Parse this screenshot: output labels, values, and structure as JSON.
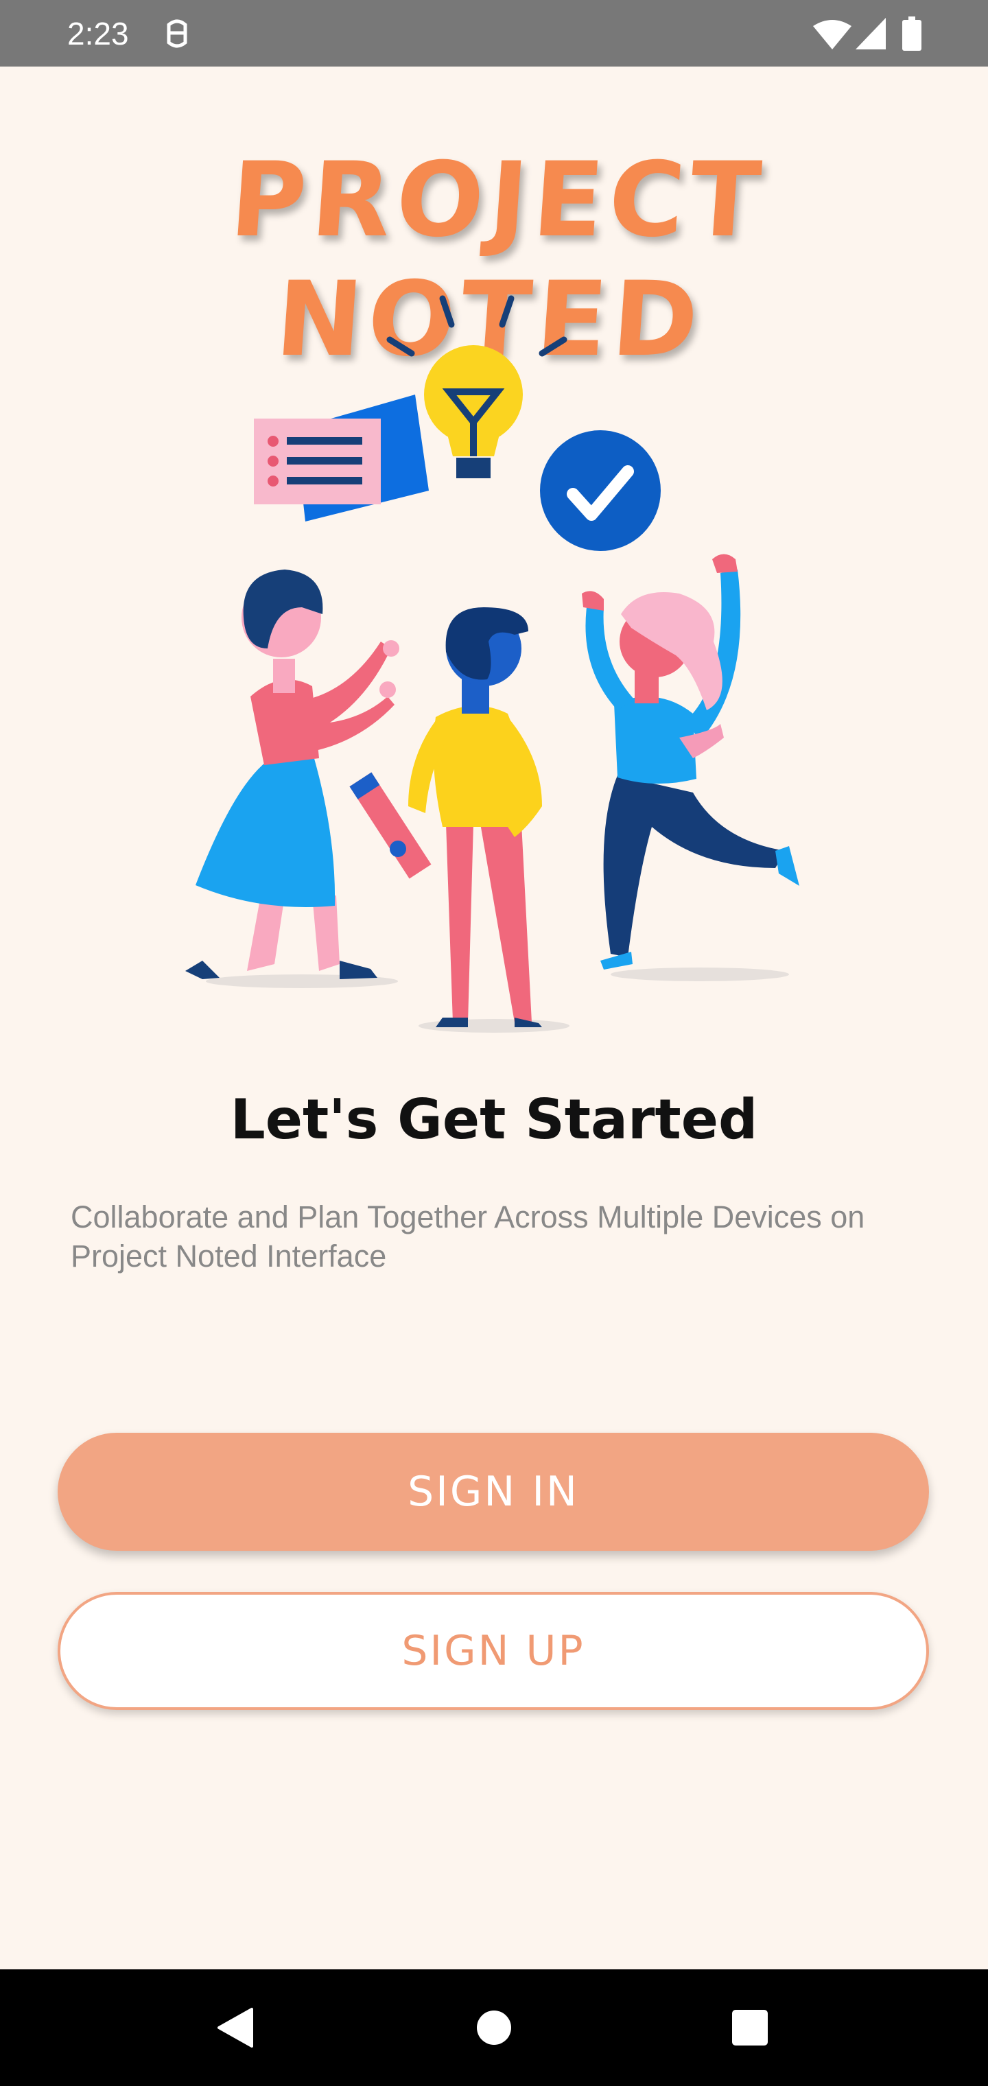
{
  "status_bar": {
    "time": "2:23",
    "icons": [
      "notification-icon",
      "wifi-icon",
      "signal-icon",
      "battery-icon"
    ]
  },
  "app": {
    "logo_text": "PROJECT NOTED"
  },
  "main": {
    "headline": "Let's Get Started",
    "description": "Collaborate and Plan Together Across Multiple Devices on Project Noted Interface"
  },
  "buttons": {
    "sign_in": "SIGN IN",
    "sign_up": "SIGN UP"
  },
  "nav_bar": {
    "items": [
      "back-icon",
      "home-icon",
      "recents-icon"
    ]
  },
  "colors": {
    "background": "#fdf5ee",
    "accent": "#f68a4f",
    "button_fill": "#f2a583",
    "status_bar": "#787878"
  }
}
